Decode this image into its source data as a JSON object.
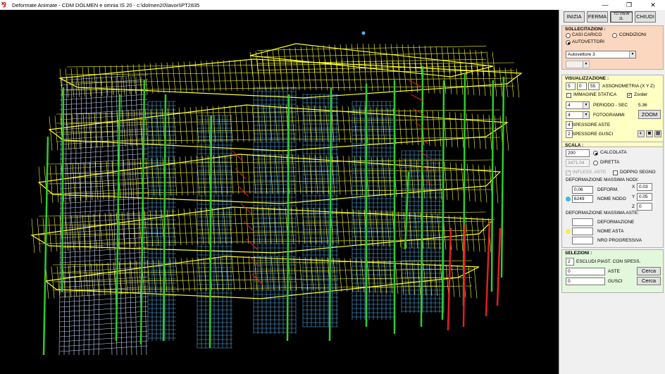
{
  "window": {
    "title": "Deformate Animate - CDM DOLMEN e omnia IS 20 - c:\\dolmen20\\lavori\\PT2835",
    "minimize": "—",
    "maximize": "❐",
    "close": "✕"
  },
  "toolbar": {
    "start_label": "INIZIA",
    "stop_label": "FERMA",
    "view_label": "TO VIEW 2L",
    "close_label": "CHIUDI"
  },
  "sollecitazioni": {
    "title": "SOLLECITAZIONI :",
    "opt_casi": "CASI CARICO",
    "opt_condizioni": "CONDIZIONI",
    "opt_autovettori": "AUTOVETTORI",
    "selected": "AUTOVETTORI",
    "autovettore_value": "Autovettore 3",
    "secondary_value": "",
    "bg_color": "#fbd7bf"
  },
  "visualizzazione": {
    "title": "VISUALIZZAZIONE :",
    "axis_x": "5",
    "axis_y": "0",
    "axis_z": "55",
    "axis_label": "ASSONOMETRIA (X Y Z)",
    "immagine_statica": "IMMAGINE STATICA",
    "immagine_statica_checked": false,
    "zorder": "Zorder",
    "zorder_checked": true,
    "periodo_select": "4",
    "periodo_label": "PERIODO - SEC",
    "periodo_value": "5.36",
    "fotogrammi_select": "4",
    "fotogrammi_label": "FOTOGRAMMI",
    "zoom_label": "ZOOM",
    "spessore_aste_value": "4",
    "spessore_aste_label": "SPESSORE ASTE",
    "spessore_gusci_value": "2",
    "spessore_gusci_label": "SPESSORE GUSCI",
    "bg_color": "#ffffc4"
  },
  "scala": {
    "title": "SCALA :",
    "scale_value": "200",
    "calcolata": "CALCOLATA",
    "diretta_value": "3471.04",
    "diretta": "DIRETTA",
    "selected": "CALCOLATA",
    "infless_aste": "INFLESS. ASTE",
    "doppio_segno": "DOPPIO SEGNO",
    "def_max_nodi_label": "DEFORMAZIONE MASSIMA NODI:",
    "deform_value": "0.06",
    "deform_label": "DEFORM.",
    "nome_nodo_value": "6249",
    "nome_nodo_label": "NOME NODO",
    "x_label": "X",
    "x_value": "0.03",
    "y_label": "Y",
    "y_value": "0.05",
    "z_label": "Z",
    "z_value": "0",
    "def_max_aste_label": "DEFORMAZIONE MASSIMA ASTE:",
    "deformazione_value": "",
    "deformazione_label": "DEFORMAZIONE",
    "nome_asta_value": "",
    "nome_asta_label": "NOME ASTA",
    "nro_progressiva_value": "",
    "nro_progressiva_label": "NRO PROGRESSIVA",
    "nodo_dot_color": "#39b7f0",
    "asta_dot_color": "#f5f04a"
  },
  "selezioni": {
    "title": "SELEZIONI :",
    "escludi_value": "2",
    "escludi_label": "ESCLUDI PIAST. CON SPESS.",
    "aste_value": "0",
    "aste_label": "ASTE",
    "gusci_value": "0",
    "gusci_label": "GUSCI",
    "cerca_label": "Cerca",
    "bg_color": "#e3f7dc"
  },
  "model_colors": {
    "slab": "#ffff2e",
    "column": "#2ecc2e",
    "wall": "#5aaee8",
    "brace": "#e02020",
    "light_wall": "#c8d8ff"
  }
}
